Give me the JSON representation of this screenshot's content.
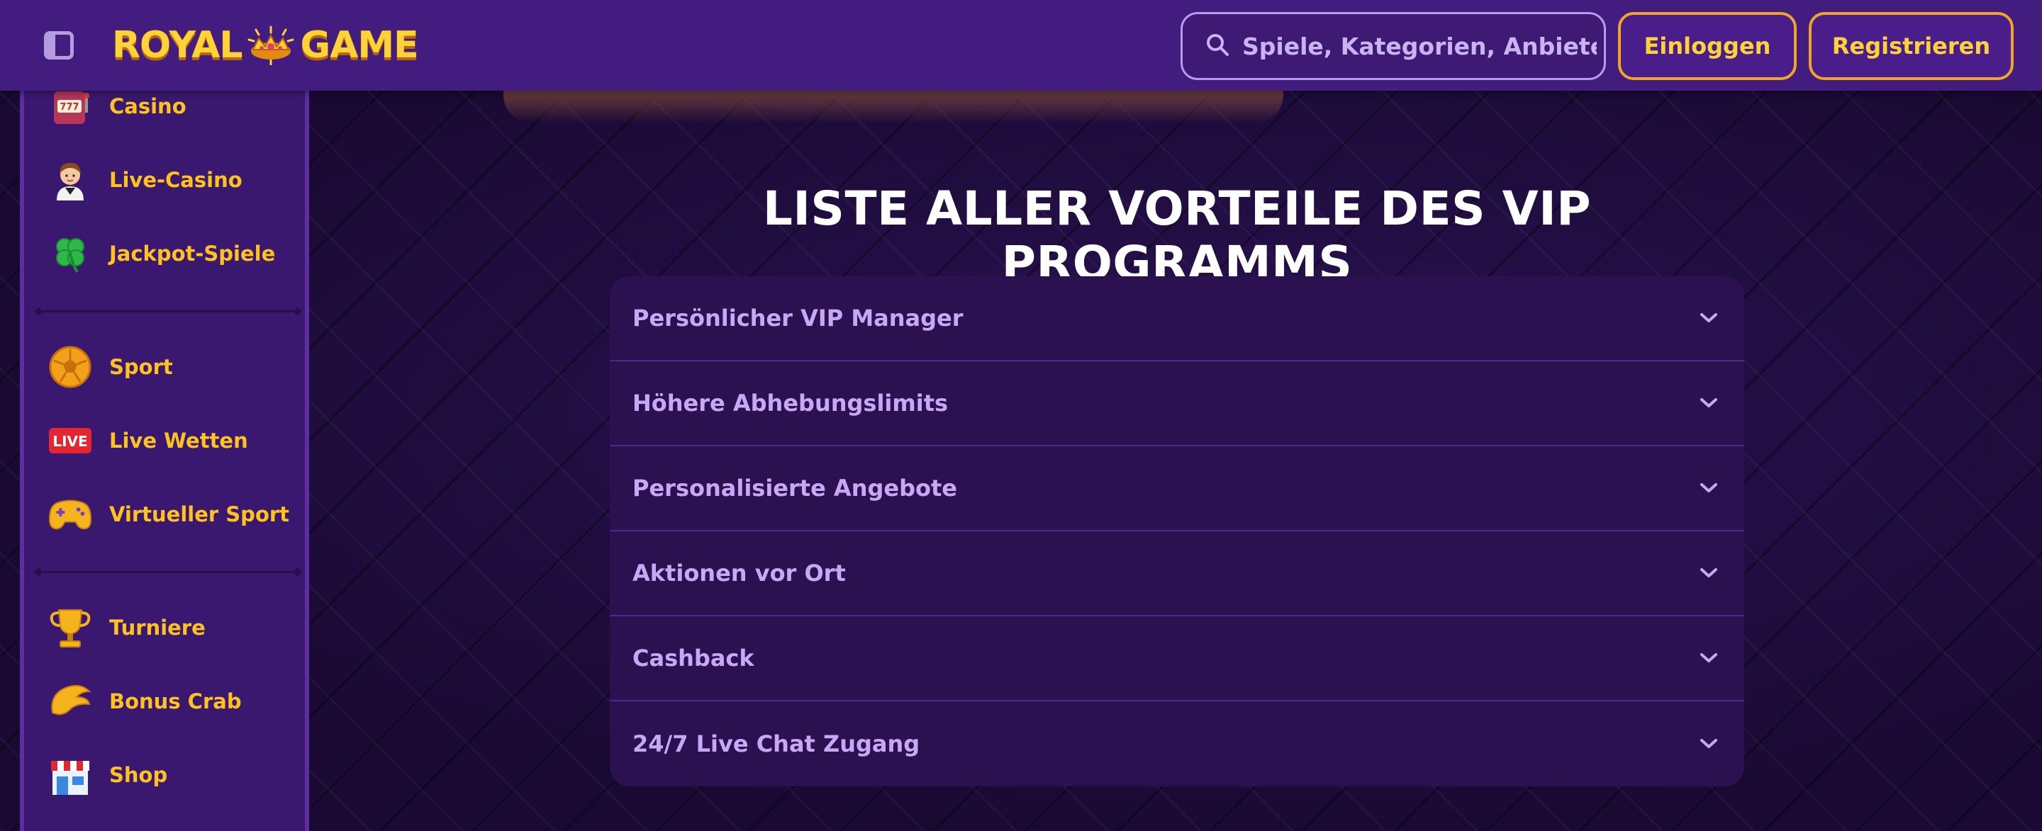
{
  "header": {
    "logo_text_left": "ROYAL",
    "logo_text_right": "GAME",
    "search_placeholder": "Spiele, Kategorien, Anbieter",
    "login_label": "Einloggen",
    "register_label": "Registrieren"
  },
  "sidebar": {
    "items": [
      {
        "label": "Casino",
        "icon": "slot-machine-icon"
      },
      {
        "label": "Live-Casino",
        "icon": "dealer-icon"
      },
      {
        "label": "Jackpot-Spiele",
        "icon": "clover-icon"
      },
      {
        "label": "Sport",
        "icon": "football-icon"
      },
      {
        "label": "Live Wetten",
        "icon": "live-badge-icon",
        "badge": "LIVE"
      },
      {
        "label": "Virtueller Sport",
        "icon": "gamepad-icon"
      },
      {
        "label": "Turniere",
        "icon": "trophy-icon"
      },
      {
        "label": "Bonus Crab",
        "icon": "crab-claw-icon"
      },
      {
        "label": "Shop",
        "icon": "shop-icon"
      }
    ]
  },
  "main": {
    "title": "LISTE ALLER VORTEILE DES VIP PROGRAMMS",
    "benefits": [
      {
        "label": "Persönlicher VIP Manager"
      },
      {
        "label": "Höhere Abhebungslimits"
      },
      {
        "label": "Personalisierte Angebote"
      },
      {
        "label": "Aktionen vor Ort"
      },
      {
        "label": "Cashback"
      },
      {
        "label": "24/7 Live Chat Zugang"
      }
    ]
  },
  "colors": {
    "header_bg": "#431c80",
    "accent_gold": "#ffc21e",
    "button_border": "#f0a52a",
    "accordion_bg": "#2b114f",
    "accordion_text": "#c8a8f5"
  }
}
